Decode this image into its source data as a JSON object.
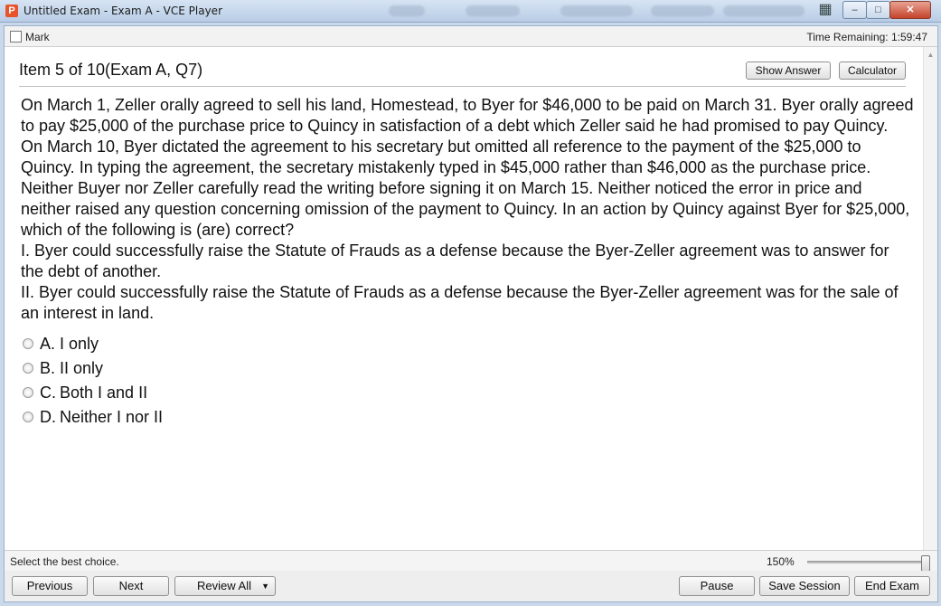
{
  "window": {
    "title": "Untitled Exam - Exam A - VCE Player",
    "app_icon_letter": "P",
    "min_glyph": "–",
    "max_glyph": "□",
    "close_glyph": "✕"
  },
  "topbar": {
    "mark_label": "Mark",
    "time_remaining": "Time Remaining: 1:59:47"
  },
  "header": {
    "item_title": "Item 5 of 10(Exam A, Q7)",
    "show_answer_label": "Show Answer",
    "calculator_label": "Calculator"
  },
  "question": {
    "text": "On March 1, Zeller orally agreed to sell his land, Homestead, to Byer for $46,000 to be paid on March 31. Byer orally agreed to pay $25,000 of the purchase price to Quincy in satisfaction of a debt which Zeller said he had promised to pay Quincy.  On March 10, Byer dictated the agreement to his secretary but omitted all reference to the payment of the $25,000 to Quincy. In typing the agreement, the secretary mistakenly typed in $45,000 rather than $46,000 as the purchase price. Neither Buyer nor Zeller carefully read the writing before signing it on March 15. Neither noticed the error in price and neither raised any question concerning omission of the payment to Quincy. In an action by Quincy against Byer for $25,000, which of the following is (are) correct?\nI. Byer could successfully raise the Statute of Frauds as a defense because the Byer-Zeller agreement was to answer for the debt of another.\nII. Byer could successfully raise the Statute of Frauds as a defense because the Byer-Zeller agreement was for the sale of an interest in land."
  },
  "choices": [
    {
      "letter": "A.",
      "text": "I only"
    },
    {
      "letter": "B.",
      "text": "II only"
    },
    {
      "letter": "C.",
      "text": "Both I and II"
    },
    {
      "letter": "D.",
      "text": "Neither I nor II"
    }
  ],
  "status": {
    "instruction": "Select the best choice.",
    "zoom": "150%",
    "zoom_fraction": 1.0
  },
  "bottom": {
    "previous_label": "Previous",
    "next_label": "Next",
    "review_all_label": "Review All",
    "review_caret": "▼",
    "pause_label": "Pause",
    "save_session_label": "Save Session",
    "end_exam_label": "End Exam"
  },
  "scroll": {
    "up_glyph": "▲",
    "down_glyph": "▼"
  }
}
